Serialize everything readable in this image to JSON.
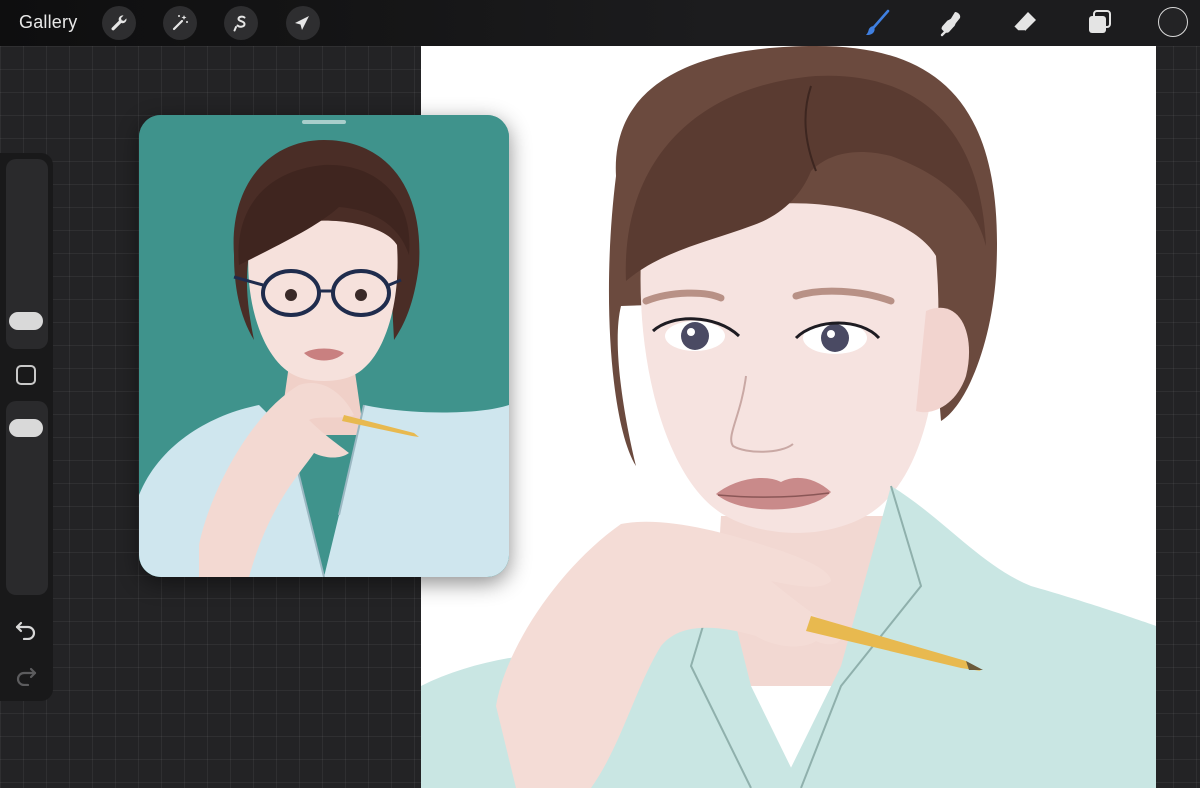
{
  "toolbar": {
    "gallery_label": "Gallery",
    "left_actions": [
      {
        "name": "wrench-icon",
        "role": "actions"
      },
      {
        "name": "magic-wand-icon",
        "role": "adjustments"
      },
      {
        "name": "selection-icon",
        "role": "selection"
      },
      {
        "name": "arrow-cursor-icon",
        "role": "transform"
      }
    ],
    "right_tools": [
      {
        "name": "brush-icon",
        "role": "paint",
        "active": true
      },
      {
        "name": "smudge-icon",
        "role": "smudge"
      },
      {
        "name": "eraser-icon",
        "role": "eraser"
      },
      {
        "name": "layers-icon",
        "role": "layers"
      }
    ],
    "active_tool_color": "#3f7fe0",
    "current_color": "#232325"
  },
  "sidebar": {
    "brush_size_icon": "slider-thumb",
    "modify_icon": "square-icon",
    "opacity_icon": "slider-thumb",
    "undo_icon": "undo-icon",
    "redo_icon": "redo-icon"
  },
  "reference_window": {
    "background_color": "#3f938c",
    "handle_icon": "drag-handle"
  },
  "canvas": {
    "background_color": "#ffffff"
  }
}
